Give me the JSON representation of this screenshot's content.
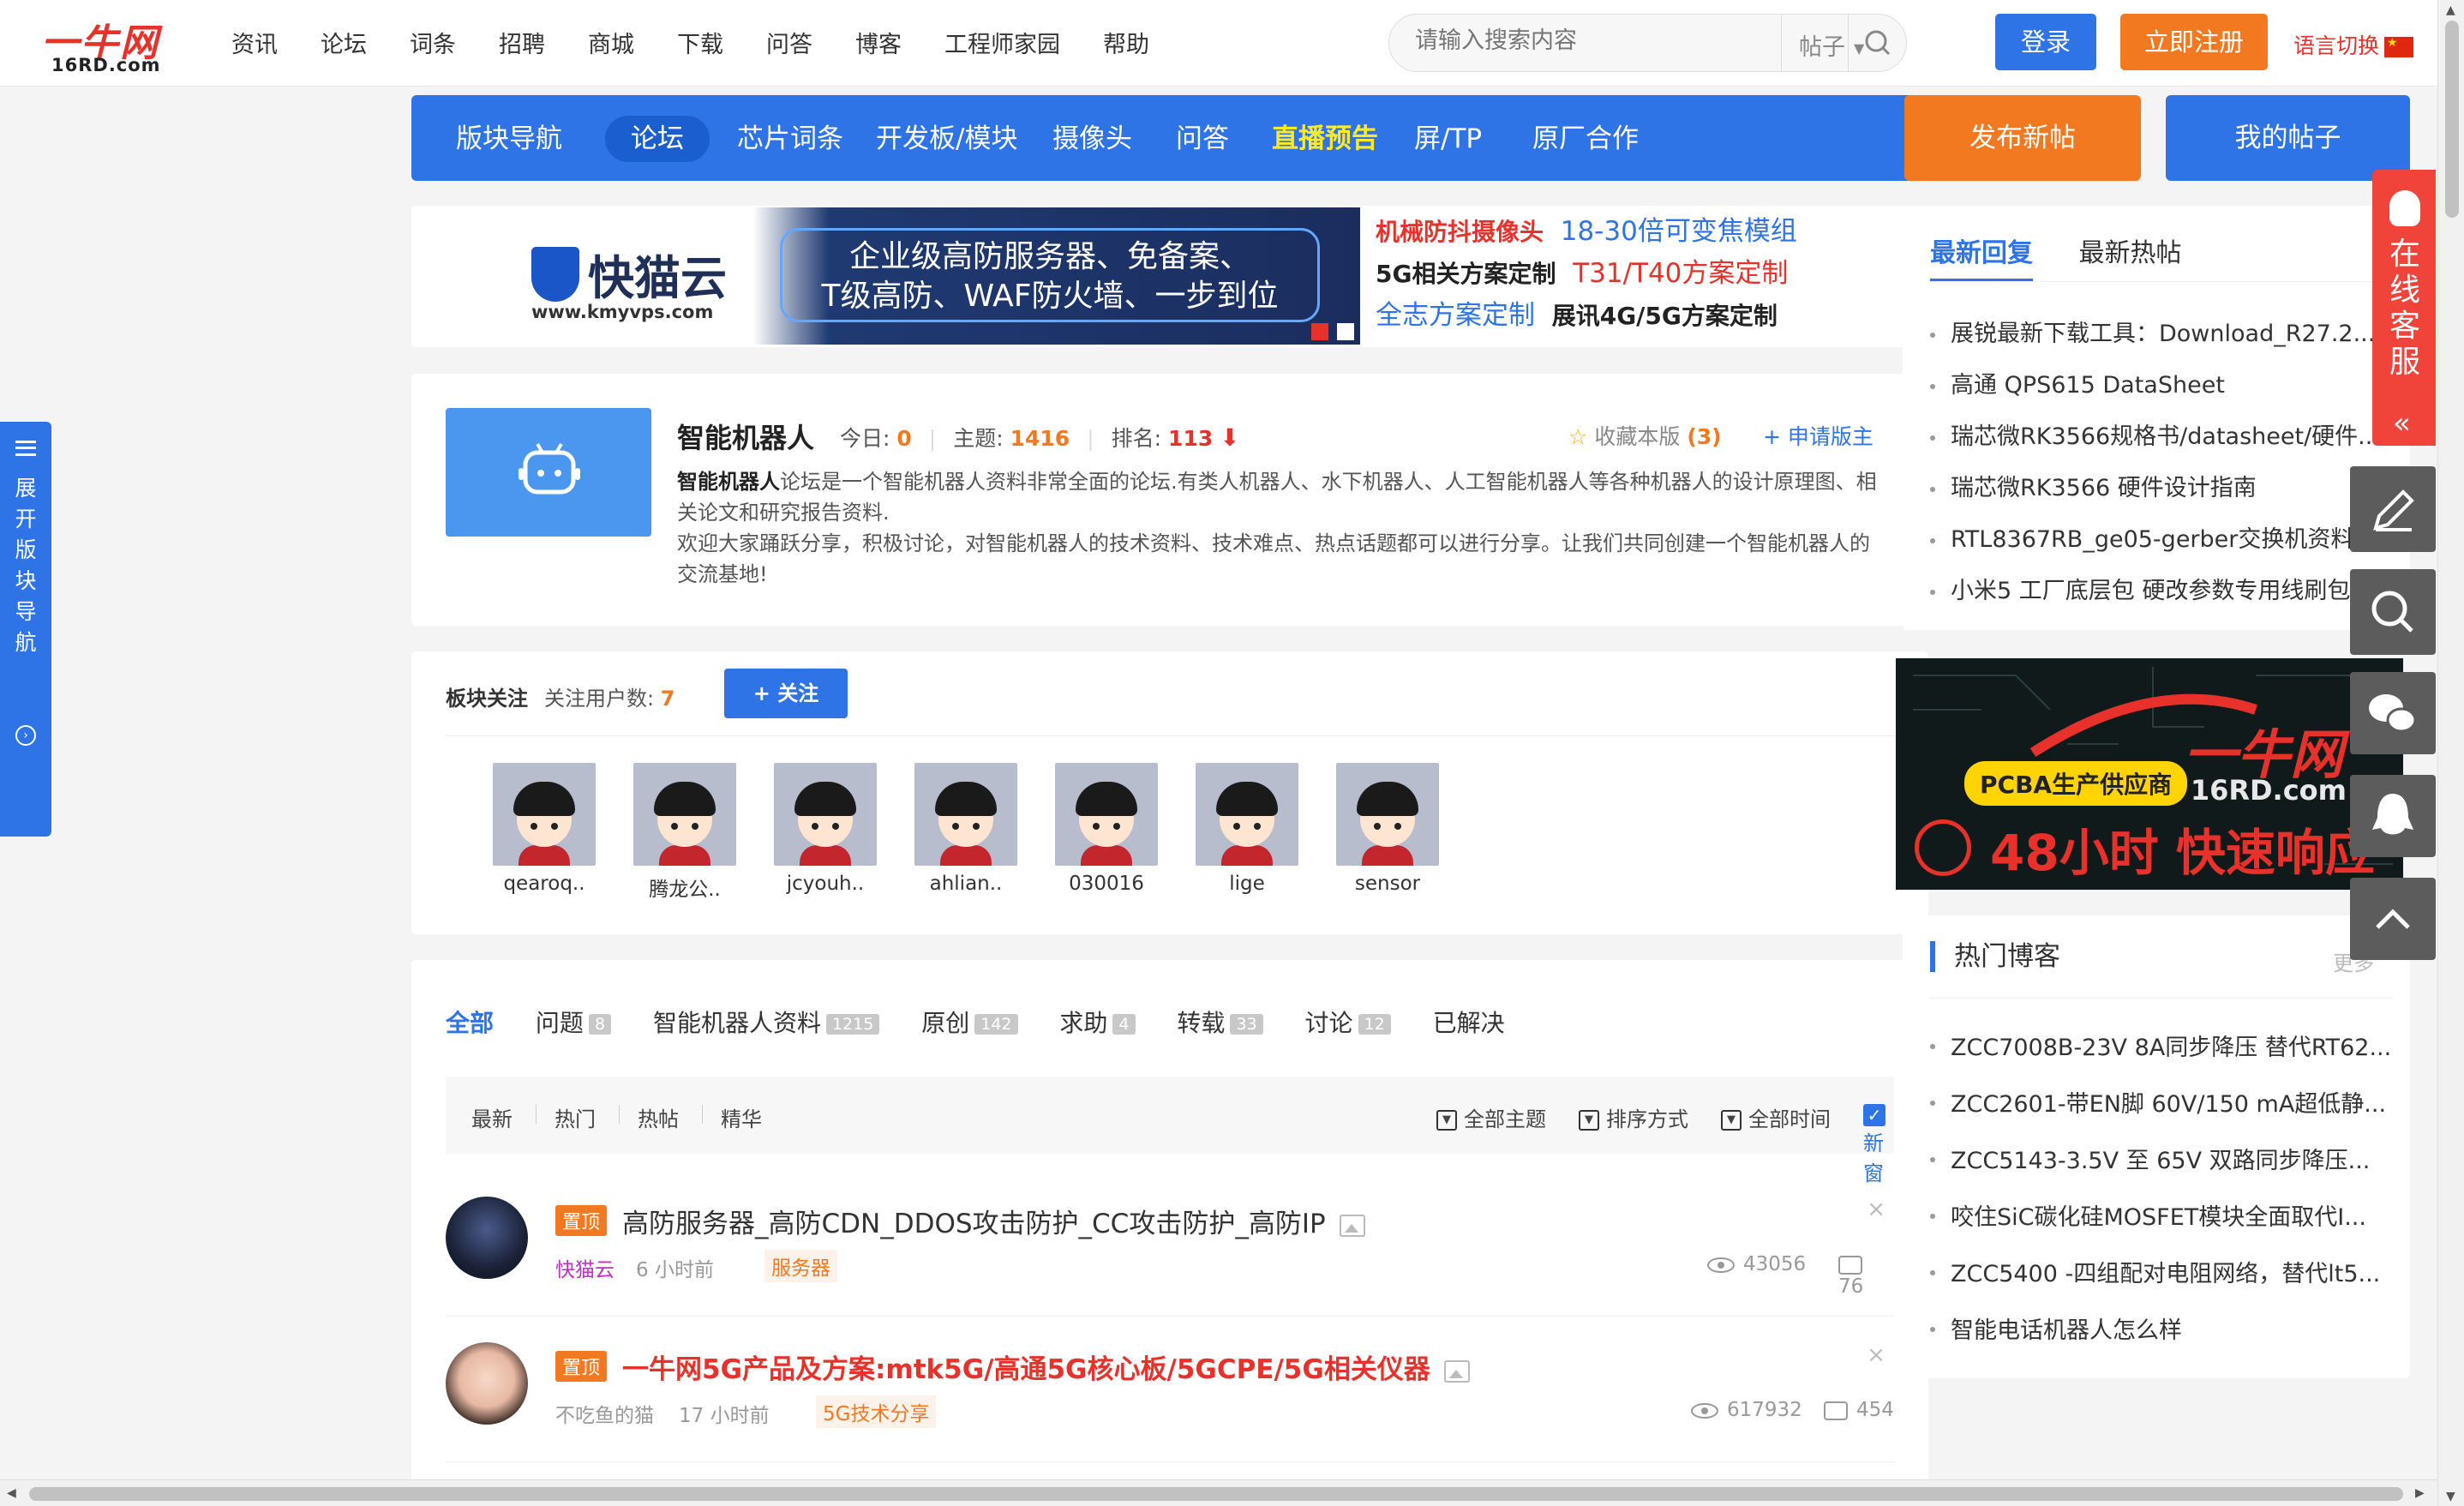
{
  "header": {
    "logo_main": "一牛网",
    "logo_sub": "16RD.com",
    "nav": [
      "资讯",
      "论坛",
      "词条",
      "招聘",
      "商城",
      "下载",
      "问答",
      "博客",
      "工程师家园",
      "帮助"
    ],
    "search_placeholder": "请输入搜索内容",
    "search_type": "帖子",
    "login": "登录",
    "register": "立即注册",
    "language": "语言切换"
  },
  "mainnav": {
    "items": [
      {
        "label": "版块导航"
      },
      {
        "label": "论坛",
        "active": true
      },
      {
        "label": "芯片词条"
      },
      {
        "label": "开发板/模块"
      },
      {
        "label": "摄像头"
      },
      {
        "label": "问答"
      },
      {
        "label": "直播预告",
        "highlight": true
      },
      {
        "label": "屏/TP"
      },
      {
        "label": "原厂合作"
      }
    ],
    "post_new": "发布新帖",
    "my_posts": "我的帖子"
  },
  "ad_banner": {
    "brand": "快猫云",
    "url": "www.kmyvps.com",
    "slogan_line1": "企业级高防服务器、免备案、",
    "slogan_line2": "T级高防、WAF防火墙、一步到位",
    "links": {
      "l1a": "机械防抖摄像头",
      "l1b": "18-30倍可变焦模组",
      "l2a": "5G相关方案定制",
      "l2b": "T31/T40方案定制",
      "l3a": "全志方案定制",
      "l3b": "展讯4G/5G方案定制"
    }
  },
  "forum": {
    "title": "智能机器人",
    "today_label": "今日:",
    "today": "0",
    "topics_label": "主题:",
    "topics": "1416",
    "rank_label": "排名:",
    "rank": "113",
    "fav_label": "收藏本版",
    "fav_count": "(3)",
    "apply": "+ 申请版主",
    "desc_bold": "智能机器人",
    "desc_1": "论坛是一个智能机器人资料非常全面的论坛.有类人机器人、水下机器人、人工智能机器人等各种机器人的设计原理图、相关论文和研究报告资料.",
    "desc_2": "欢迎大家踊跃分享，积极讨论，对智能机器人的技术资料、技术难点、热点话题都可以进行分享。让我们共同创建一个智能机器人的交流基地!"
  },
  "follow": {
    "label": "板块关注",
    "count_label": "关注用户数:",
    "count": "7",
    "button": "+ 关注",
    "users": [
      "qearoq..",
      "腾龙公..",
      "jcyouh..",
      "ahlian..",
      "030016",
      "lige",
      "sensor"
    ]
  },
  "posts": {
    "tabs": [
      {
        "label": "全部",
        "active": true
      },
      {
        "label": "问题",
        "count": "8"
      },
      {
        "label": "智能机器人资料",
        "count": "1215"
      },
      {
        "label": "原创",
        "count": "142"
      },
      {
        "label": "求助",
        "count": "4"
      },
      {
        "label": "转载",
        "count": "33"
      },
      {
        "label": "讨论",
        "count": "12"
      },
      {
        "label": "已解决"
      }
    ],
    "sorts": [
      "最新",
      "热门",
      "热帖",
      "精华"
    ],
    "filters": {
      "topics": "全部主题",
      "order": "排序方式",
      "time": "全部时间",
      "new_window": "新窗"
    },
    "items": [
      {
        "pin": "置顶",
        "title": "高防服务器_高防CDN_DDOS攻击防护_CC攻击防护_高防IP",
        "author": "快猫云",
        "time": "6 小时前",
        "tag": "服务器",
        "views": "43056",
        "replies": "76"
      },
      {
        "pin": "置顶",
        "title": "一牛网5G产品及方案:mtk5G/高通5G核心板/5GCPE/5G相关仪器",
        "author": "不吃鱼的猫",
        "time": "17 小时前",
        "tag": "5G技术分享",
        "views": "617932",
        "replies": "454"
      }
    ]
  },
  "sidebar": {
    "tab_latest": "最新回复",
    "tab_hot": "最新热帖",
    "latest": [
      "展锐最新下载工具：Download_R27.2...",
      "高通 QPS615 DataSheet",
      "瑞芯微RK3566规格书/datasheet/硬件...",
      "瑞芯微RK3566 硬件设计指南",
      "RTL8367RB_ge05-gerber交换机资料",
      "小米5 工厂底层包 硬改参数专用线刷包"
    ],
    "ad": {
      "brand": "一牛网",
      "url": "16RD.com",
      "pill": "PCBA生产供应商",
      "slogan": "48小时 快速响应"
    },
    "blog_title": "热门博客",
    "blog_more": "更多",
    "blogs": [
      "ZCC7008B-23V 8A同步降压 替代RT62...",
      "ZCC2601-带EN脚 60V/150 mA超低静...",
      "ZCC5143-3.5V 至 65V 双路同步降压...",
      "咬住SiC碳化硅MOSFET模块全面取代I...",
      "ZCC5400 -四组配对电阻网络，替代lt5...",
      "智能电话机器人怎么样"
    ]
  },
  "floats": {
    "cs_text": "在线客服",
    "left_text": "展开版块导航"
  },
  "colors": {
    "brand_blue": "#2e74e6",
    "brand_orange": "#f37921",
    "brand_red": "#e8312a"
  }
}
